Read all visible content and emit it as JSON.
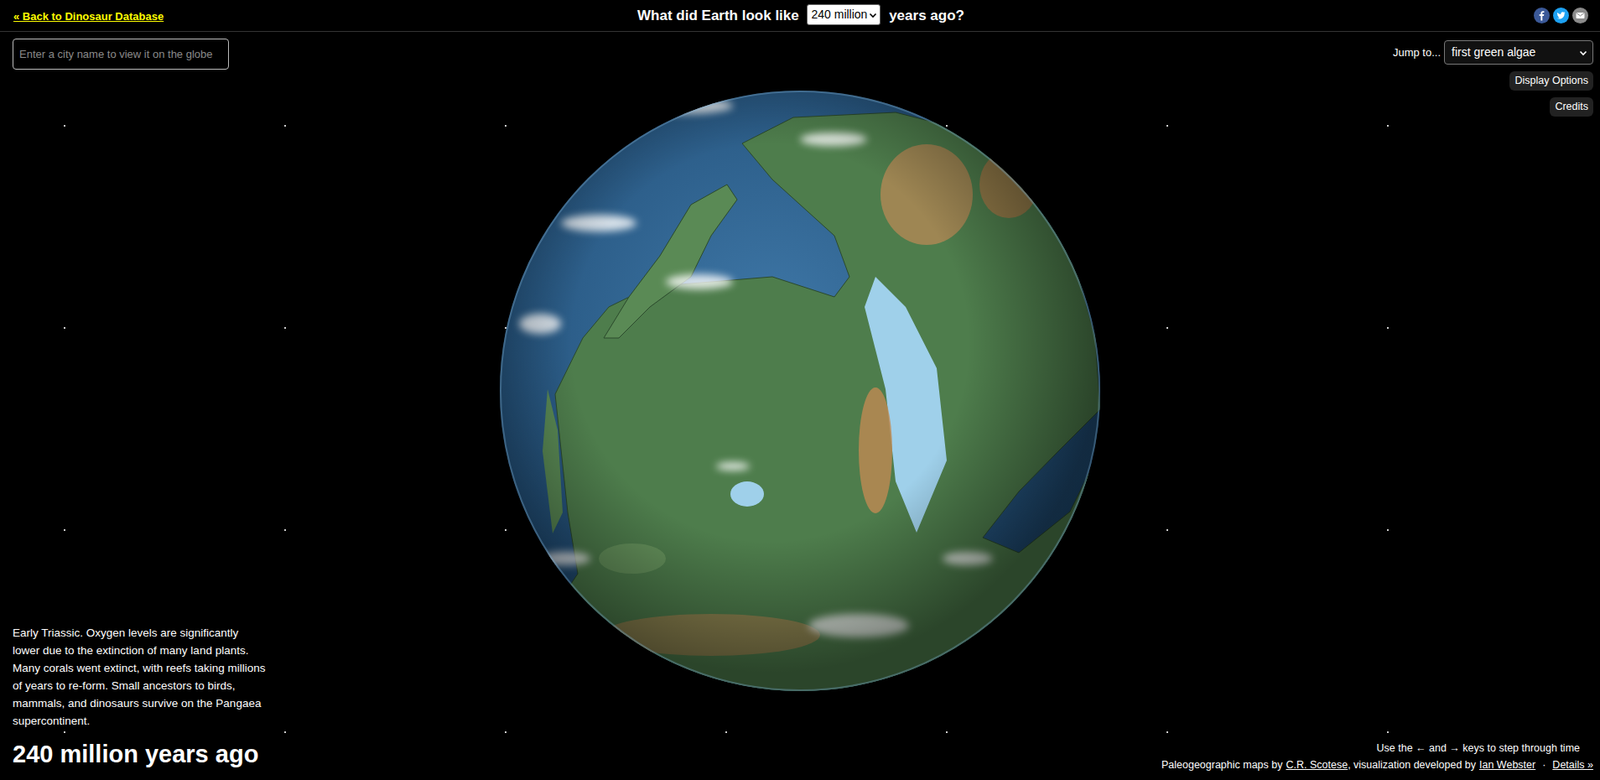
{
  "header": {
    "back_link": "« Back to Dinosaur Database",
    "title_before": "What did Earth look like",
    "time_select": "240 million",
    "title_after": "years ago?"
  },
  "search": {
    "placeholder": "Enter a city name to view it on the globe"
  },
  "jump": {
    "label": "Jump to...",
    "value": "first green algae"
  },
  "buttons": [
    "Display Options",
    "Credits"
  ],
  "description": "Early Triassic. Oxygen levels are significantly lower due to the extinction of many land plants. Many corals went extinct, with reefs taking millions of years to re-form. Small ancestors to birds, mammals, and dinosaurs survive on the Pangaea supercontinent.",
  "time_label": "240 million years ago",
  "footer": {
    "hint": "Use the ← and → keys to step through time",
    "credit_prefix": "Paleogeographic maps by",
    "credit_author": "C.R. Scotese",
    "credit_middle": ", visualization developed by",
    "credit_developer": "Ian Webster",
    "separator": "·",
    "details_link": "Details »"
  }
}
